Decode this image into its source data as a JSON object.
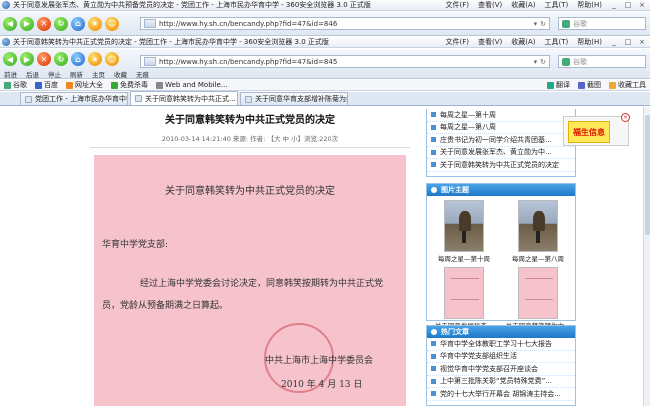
{
  "window1": {
    "title": "关于同意发展张军杰、黄立勋为中共预备党员的决定 - 党团工作 - 上海市民办华育中学 - 360安全浏览器 3.0 正式版",
    "url": "http://www.hy.sh.cn/bencandy.php?fid=47&id=846",
    "search_placeholder": "谷歌"
  },
  "window2": {
    "title": "关于同意韩笑转为中共正式党员的决定 - 党团工作 - 上海市民办华育中学 - 360安全浏览器 3.0 正式版",
    "url": "http://www.hy.sh.cn/bencandy.php?fid=47&id=845",
    "search_placeholder": "谷歌",
    "toolbar_labels": [
      "前进",
      "后退",
      "停止",
      "刷新",
      "主页",
      "收藏",
      "无痕"
    ]
  },
  "menu": [
    "文件(F)",
    "查看(V)",
    "收藏(A)",
    "工具(T)",
    "帮助(H)"
  ],
  "win_controls": [
    "_",
    "□",
    "×"
  ],
  "bookmarks": [
    "谷歌",
    "百度",
    "网址大全",
    "免费杀毒",
    "Web and Mobile..."
  ],
  "bookmarks_right": [
    "翻译",
    "截图",
    "收藏",
    "收藏工具"
  ],
  "tabs": [
    {
      "label": "党团工作 - 上海市民办华育中学",
      "active": false
    },
    {
      "label": "关于同意韩笑转为中共正式...",
      "active": true
    },
    {
      "label": "关于同意华育支部增补陈菊为组...",
      "active": false
    }
  ],
  "article": {
    "title": "关于同意韩笑转为中共正式党员的决定",
    "meta": "2010-03-14 14:21:40 来源:  作者:  【大 中 小】浏览:220次",
    "doc_title": "关于同意韩笑转为中共正式党员的决定",
    "greeting": "华育中学党支部:",
    "body_line1": "经过上海中学党委会讨论决定，同意韩笑按期转为中共正式党",
    "body_line2": "员，党龄从预备期满之日算起。",
    "signature": "中共上海市上海中学委员会",
    "date": "2010 年 4 月 13 日"
  },
  "sidebar": {
    "list1": [
      "每周之星—第十周",
      "每周之星—第八周",
      "庄贵书记为初一同学介绍共青团基...",
      "关于同意发展张军杰、黄立勋为中...",
      "关于同意韩笑转为中共正式党员的决定"
    ],
    "photos_title": "图片主题",
    "photos": [
      {
        "caption": "每周之星—第十周",
        "kind": "tree"
      },
      {
        "caption": "每周之星—第八周",
        "kind": "tree"
      },
      {
        "caption": "关于同意发展张杰...",
        "kind": "doc"
      },
      {
        "caption": "关于同意韩笑转为中...",
        "kind": "doc"
      }
    ],
    "hot_title": "热门文章",
    "hot": [
      "华育中学全体教职工学习十七大报告",
      "华育中学党支部组织生活",
      "视觉华育中学党支部召开座谈会",
      "上中第三批陈关彰“党员特殊党费”...",
      "党的十七大举行开幕会 胡锦涛主持会..."
    ]
  },
  "ad": {
    "label": "福生信息"
  }
}
